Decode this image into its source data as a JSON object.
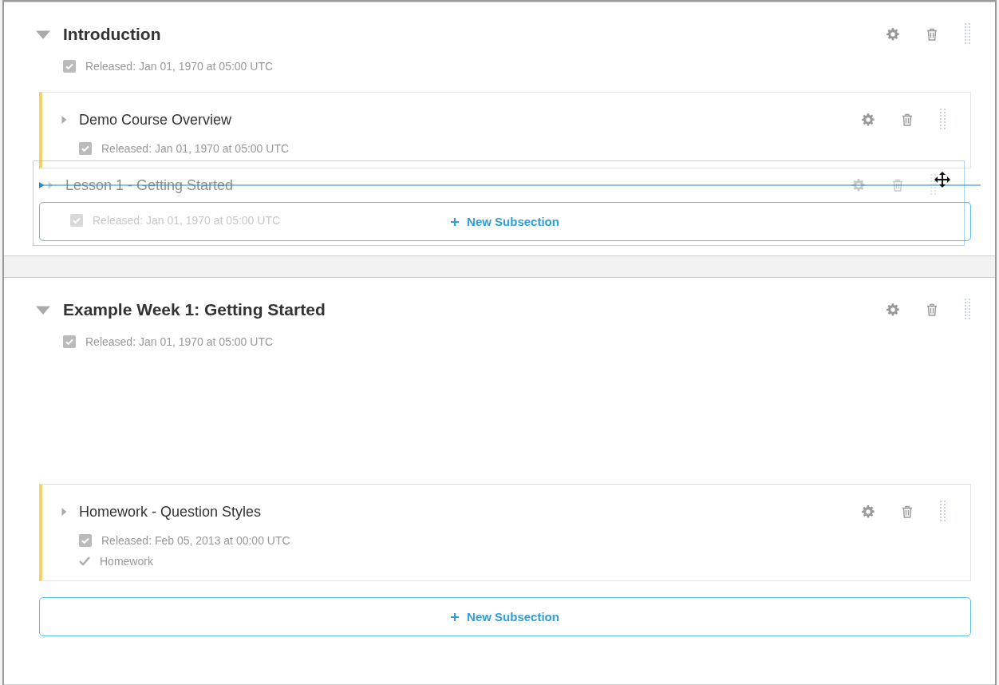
{
  "sections": [
    {
      "title": "Introduction",
      "expanded": true,
      "release": "Released: Jan 01, 1970 at 05:00 UTC",
      "subsections": [
        {
          "title": "Demo Course Overview",
          "release": "Released: Jan 01, 1970 at 05:00 UTC",
          "expanded": false
        }
      ],
      "dragged_subsection": {
        "title": "Lesson 1 - Getting Started",
        "release": "Released: Jan 01, 1970 at 05:00 UTC",
        "expanded": false
      },
      "new_subsection": "New Subsection"
    },
    {
      "title": "Example Week 1: Getting Started",
      "expanded": true,
      "release": "Released: Jan 01, 1970 at 05:00 UTC",
      "subsections": [
        {
          "title": "Homework - Question Styles",
          "release": "Released: Feb 05, 2013 at 00:00 UTC",
          "expanded": false,
          "grading": "Homework"
        }
      ],
      "new_subsection": "New Subsection"
    }
  ]
}
